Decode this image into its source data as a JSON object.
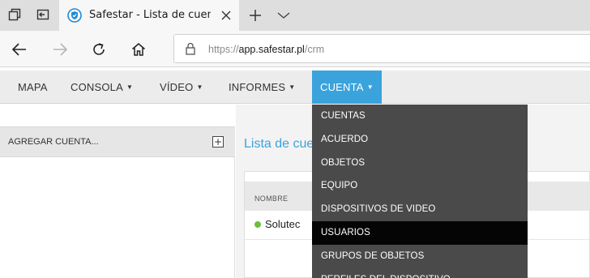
{
  "browser": {
    "tab_title": "Safestar - Lista de cuent",
    "url_prefix": "https://",
    "url_host": "app.safestar.pl",
    "url_path": "/crm"
  },
  "nav": {
    "items": [
      {
        "label": "MAPA",
        "has_caret": false
      },
      {
        "label": "CONSOLA",
        "has_caret": true
      },
      {
        "label": "VÍDEO",
        "has_caret": true
      },
      {
        "label": "INFORMES",
        "has_caret": true
      },
      {
        "label": "CUENTA",
        "has_caret": true,
        "active": true
      }
    ],
    "caret": "▼"
  },
  "sidebar": {
    "title": "AGREGAR CUENTA...",
    "add_symbol": "+"
  },
  "main": {
    "title": "Lista de cuentas",
    "column_header": "NOMBRE",
    "rows": [
      {
        "name": "Solutec",
        "status": "online"
      }
    ]
  },
  "dropdown": {
    "items": [
      "CUENTAS",
      "ACUERDO",
      "OBJETOS",
      "EQUIPO",
      "DISPOSITIVOS DE VIDEO",
      "USUARIOS",
      "GRUPOS DE OBJETOS",
      "PERFILES DEL DISPOSITIVO"
    ],
    "highlighted": "USUARIOS"
  },
  "colors": {
    "accent": "#3aa3dc",
    "dropdown_bg": "#4a4a4a",
    "dropdown_hover": "#050505",
    "status_online": "#6cbf3a"
  },
  "icons": {
    "tab_actions": "tab-actions-icon",
    "back_tabs": "set-aside-tabs-icon",
    "favicon": "shield-favicon-icon",
    "close": "close-icon",
    "new_tab": "plus-icon",
    "tab_dropdown": "chevron-down-icon",
    "back": "back-arrow-icon",
    "forward": "forward-arrow-icon",
    "refresh": "refresh-icon",
    "home": "home-icon",
    "lock": "lock-icon"
  }
}
